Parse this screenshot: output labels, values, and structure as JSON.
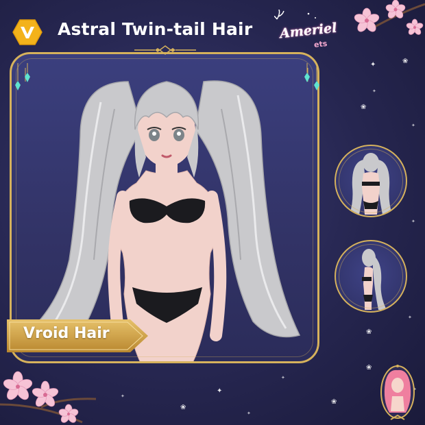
{
  "header": {
    "title": "Astral Twin-tail Hair",
    "badge_icon": "vroid-v-icon",
    "logo_name": "Ameriel",
    "logo_sub": "ets"
  },
  "main": {
    "ribbon_label": "Vroid Hair"
  },
  "thumbnails": [
    {
      "name": "back-view"
    },
    {
      "name": "side-view"
    }
  ],
  "colors": {
    "background": "#262650",
    "gold": "#d6b25c",
    "badge": "#f3b21b",
    "hair": "#c9c9cc",
    "blossom": "#f6c3d6"
  }
}
